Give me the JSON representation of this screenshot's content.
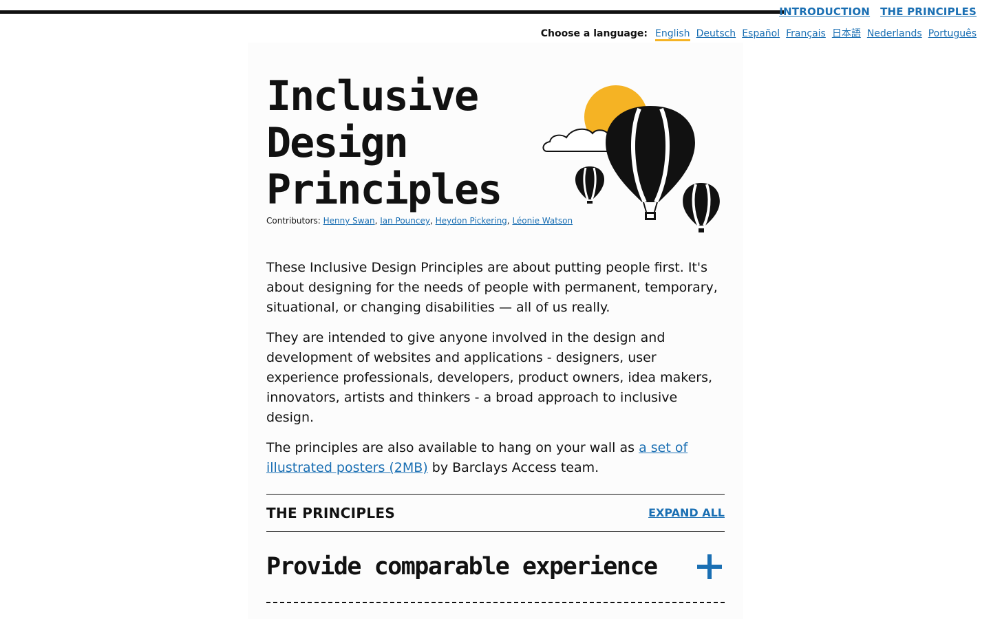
{
  "nav": {
    "items": [
      "INTRODUCTION",
      "THE PRINCIPLES"
    ]
  },
  "language": {
    "label": "Choose a language:",
    "options": [
      "English",
      "Deutsch",
      "Español",
      "Français",
      "日本語",
      "Nederlands",
      "Português"
    ],
    "selected": "English"
  },
  "hero": {
    "title_lines": [
      "Inclusive",
      "Design",
      "Principles"
    ],
    "contributors_label": "Contributors:",
    "contributors": [
      "Henny Swan",
      "Ian Pouncey",
      "Heydon Pickering",
      "Léonie Watson"
    ],
    "illustration": "hot-air-balloons-illustration"
  },
  "intro": {
    "p1": "These Inclusive Design Principles are about putting people first. It's about designing for the needs of people with permanent, temporary, situational, or changing disabilities — all of us really.",
    "p2": "They are intended to give anyone involved in the design and development of websites and applications - designers, user experience professionals, developers, product owners, idea makers, innovators, artists and thinkers - a broad approach to inclusive design.",
    "p3_before": "The principles are also available to hang on your wall as ",
    "p3_link": "a set of illustrated posters (2MB)",
    "p3_after": " by Barclays Access team."
  },
  "principles": {
    "heading": "THE PRINCIPLES",
    "expand_label": "EXPAND ALL",
    "items": [
      {
        "title": "Provide comparable experience",
        "icon": "plus-icon"
      }
    ]
  },
  "colors": {
    "link": "#1a6fb3",
    "accent": "#f5b324",
    "text": "#111111"
  }
}
